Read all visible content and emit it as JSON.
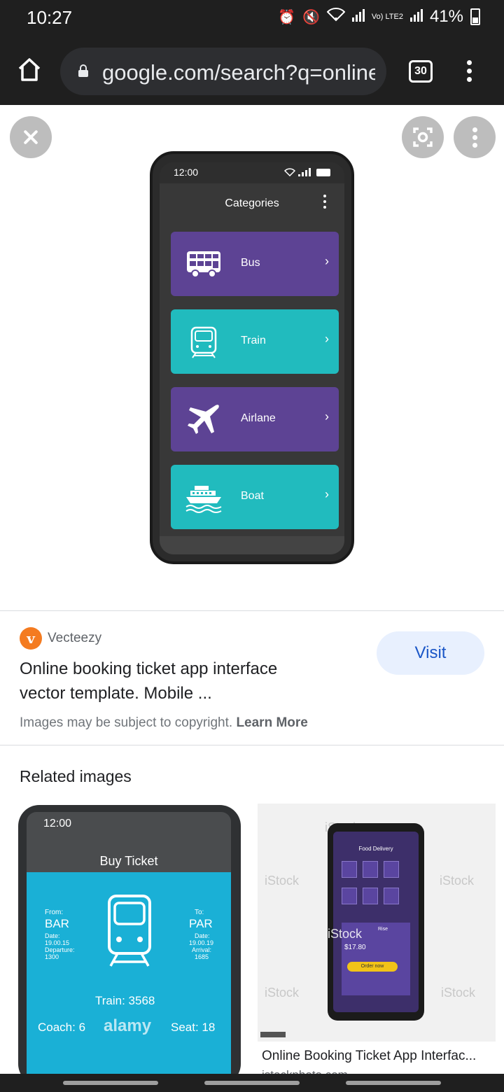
{
  "status_bar": {
    "time": "10:27",
    "network_label": "Vo) LTE2",
    "battery": "41%"
  },
  "browser": {
    "url": "google.com/search?q=online",
    "tab_count": "30"
  },
  "mock_app": {
    "time": "12:00",
    "title": "Categories",
    "categories": [
      {
        "label": "Bus",
        "color": "#5d4394",
        "icon": "bus-icon"
      },
      {
        "label": "Train",
        "color": "#21bbbe",
        "icon": "train-icon"
      },
      {
        "label": "Airlane",
        "color": "#5d4394",
        "icon": "airplane-icon"
      },
      {
        "label": "Boat",
        "color": "#21bbbe",
        "icon": "boat-icon"
      }
    ],
    "chevron": "›"
  },
  "image_info": {
    "source_logo_letter": "v",
    "source": "Vecteezy",
    "title_line1": "Online booking ticket app interface",
    "title_line2": "vector template. Mobile ...",
    "visit_label": "Visit",
    "copyright_text": "Images may be subject to copyright.",
    "learn_more": "Learn More"
  },
  "related": {
    "heading": "Related images",
    "items": [
      {
        "time": "12:00",
        "screen_title": "Buy Ticket",
        "from_label": "From:",
        "from_value": "BAR",
        "to_label": "To:",
        "to_value": "PAR",
        "date_label": "Date:",
        "date_value": "19.00.15",
        "departure_label": "Departure:",
        "departure_value": "1300",
        "date_right_value": "19.00.19",
        "arrival_label": "Arrival:",
        "arrival_value": "1685",
        "train": "Train: 3568",
        "coach": "Coach: 6",
        "seat": "Seat: 18",
        "watermark": "alamy"
      },
      {
        "screen_title": "Food Delivery",
        "item_name": "Rise",
        "price": "$17.80",
        "order_label": "Order now",
        "watermark": "iStock",
        "title": "Online Booking Ticket App Interfac...",
        "source": "istockphoto.com"
      }
    ]
  }
}
